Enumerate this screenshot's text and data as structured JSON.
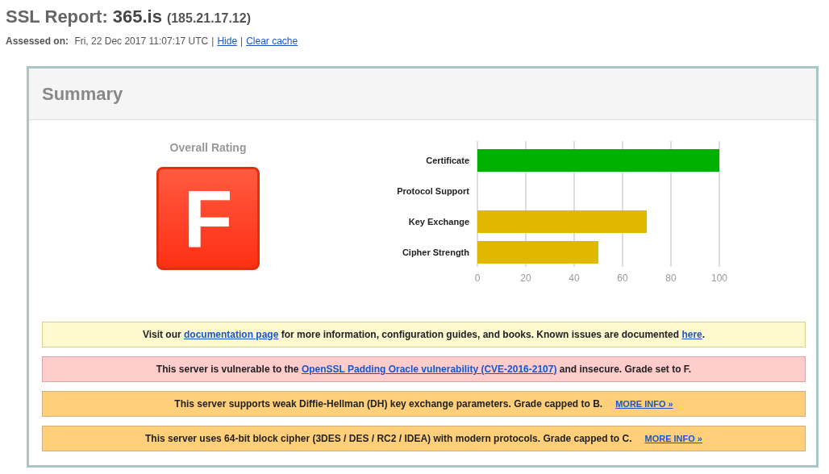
{
  "header": {
    "title": "SSL Report:",
    "host": "365.is",
    "ip": "(185.21.17.12)",
    "assessed_label": "Assessed on:",
    "assessed_value": "Fri, 22 Dec 2017 11:07:17 UTC",
    "separator": "|",
    "links": [
      "Hide",
      "Clear cache"
    ]
  },
  "summary": {
    "title": "Summary",
    "rating_label": "Overall Rating",
    "grade": "F",
    "chart_data": {
      "type": "bar",
      "orientation": "horizontal",
      "stacked": true,
      "grid": true,
      "categories": [
        "Certificate",
        "Protocol Support",
        "Key Exchange",
        "Cipher Strength"
      ],
      "series": [
        {
          "color": "#00b000",
          "values": [
            100,
            null,
            null,
            null
          ]
        },
        {
          "color": "#e0b800",
          "values": [
            null,
            null,
            70,
            50
          ]
        }
      ],
      "xlim": [
        0,
        100
      ],
      "xticks": [
        0,
        20,
        40,
        60,
        80,
        100
      ]
    },
    "messages": [
      {
        "kind": "info",
        "parts": [
          {
            "text": "Visit our "
          },
          {
            "link": "documentation page"
          },
          {
            "text": " for more information, configuration guides, and books. Known issues are documented "
          },
          {
            "link": "here"
          },
          {
            "text": "."
          }
        ]
      },
      {
        "kind": "error",
        "parts": [
          {
            "text": "This server is vulnerable to the "
          },
          {
            "link": "OpenSSL Padding Oracle vulnerability (CVE-2016-2107)"
          },
          {
            "text": " and insecure. Grade set to F."
          }
        ]
      },
      {
        "kind": "warning",
        "parts": [
          {
            "text": "This server supports weak Diffie-Hellman (DH) key exchange parameters. Grade capped to B."
          }
        ],
        "more_info": "MORE INFO »"
      },
      {
        "kind": "warning",
        "parts": [
          {
            "text": "This server uses 64-bit block cipher (3DES / DES / RC2 / IDEA) with modern protocols. Grade capped to C."
          }
        ],
        "more_info": "MORE INFO »"
      }
    ]
  }
}
